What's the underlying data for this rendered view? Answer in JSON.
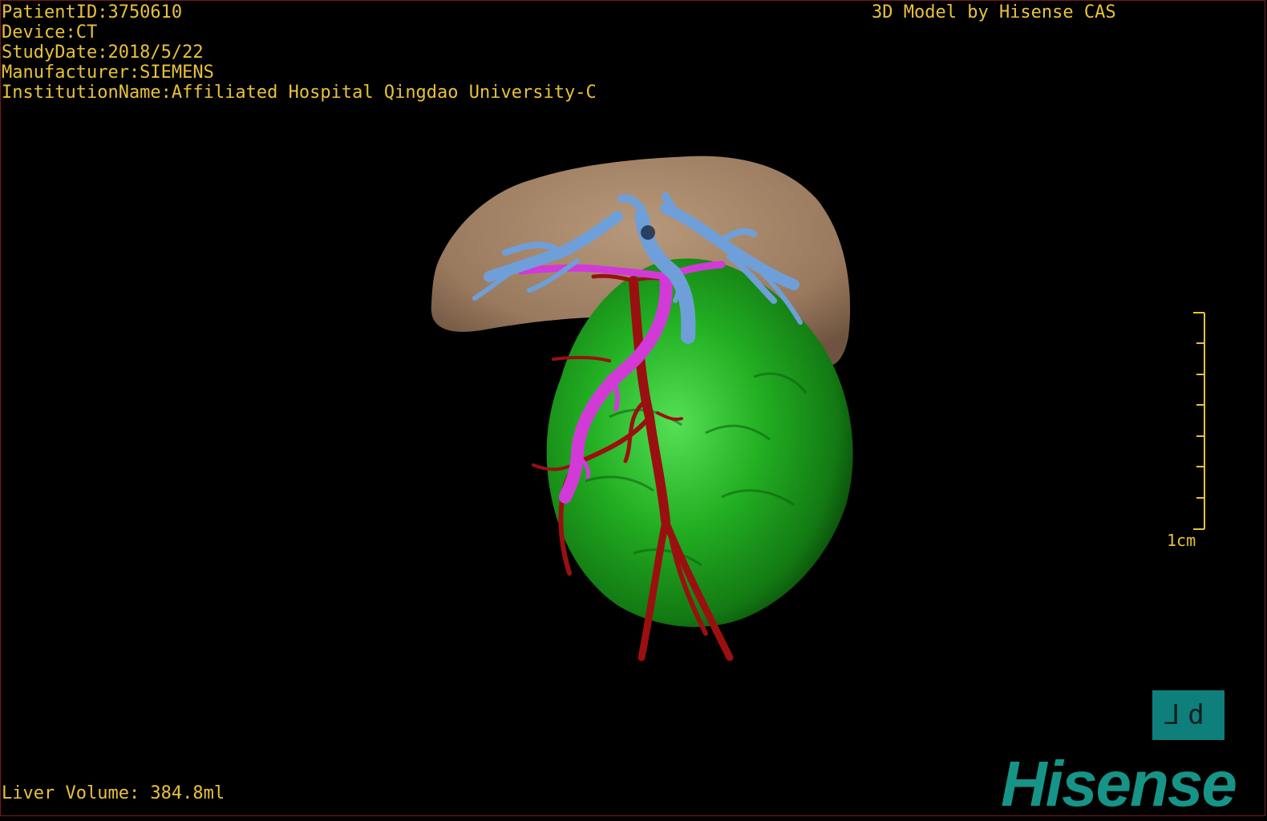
{
  "info": {
    "patient_id": "PatientID:3750610",
    "device": "Device:CT",
    "study_date": "StudyDate:2018/5/22",
    "manufacturer": "Manufacturer:SIEMENS",
    "institution": "InstitutionName:Affiliated Hospital Qingdao University-C"
  },
  "credit": "3D Model by Hisense CAS",
  "volume": "Liver Volume: 384.8ml",
  "scale": {
    "label": "1cm"
  },
  "orientation_button": {
    "label": "⅃d"
  },
  "logo": "Hisense",
  "colors": {
    "text": "#e8c23a",
    "liver": "#a08064",
    "tumor": "#1f9a1f",
    "hepatic_vein": "#6f9fd8",
    "portal_vein": "#d23ad8",
    "artery": "#9a1010",
    "logo": "#169487"
  }
}
